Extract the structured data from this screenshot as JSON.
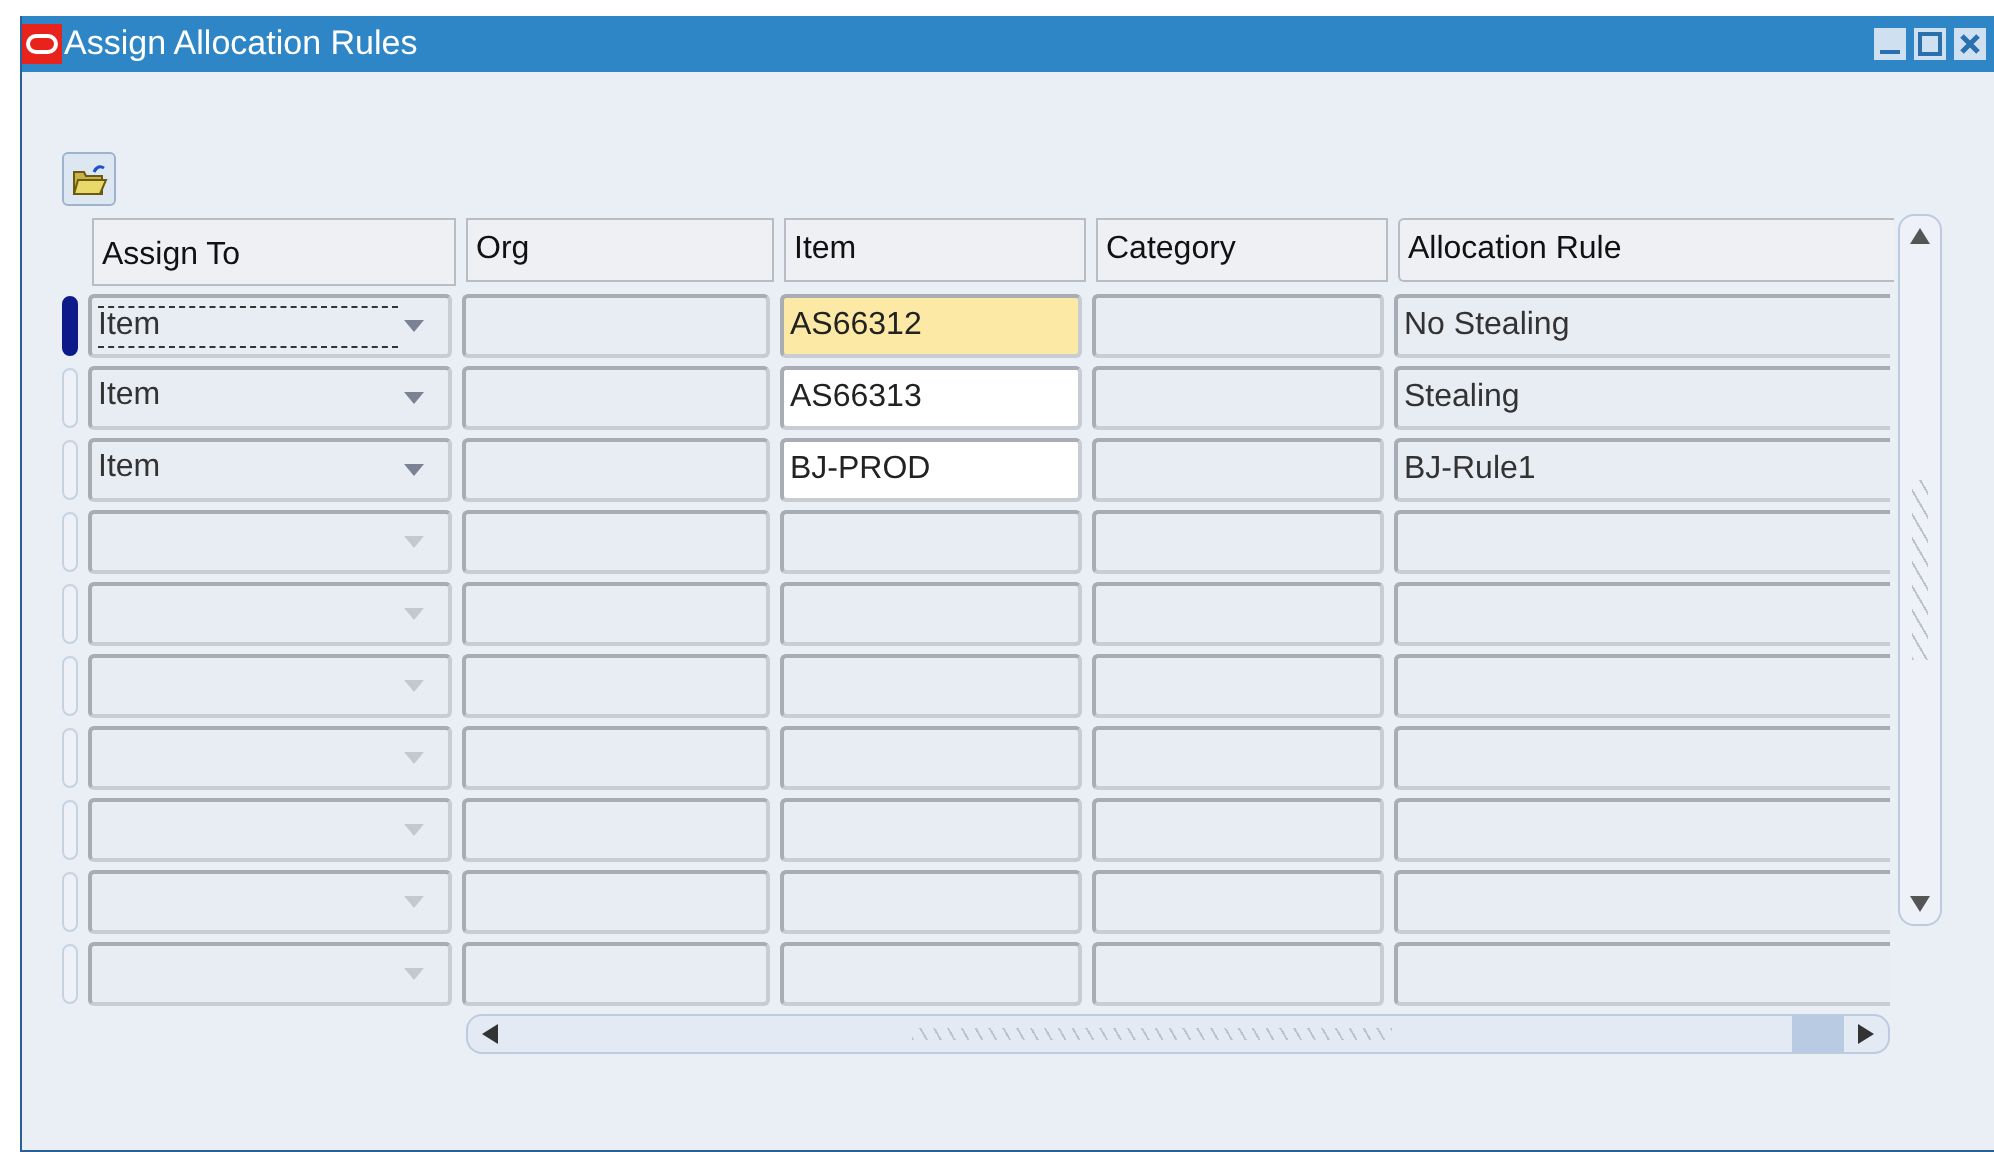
{
  "window": {
    "title": "Assign Allocation Rules"
  },
  "table": {
    "columns": [
      "Assign To",
      "Org",
      "Item",
      "Category",
      "Allocation Rule"
    ],
    "rows": [
      {
        "selected": true,
        "assign_to": "Item",
        "item": "AS66312",
        "allocation_rule": "No Stealing"
      },
      {
        "selected": false,
        "assign_to": "Item",
        "item": "AS66313",
        "allocation_rule": "Stealing"
      },
      {
        "selected": false,
        "assign_to": "Item",
        "item": "BJ-PROD",
        "allocation_rule": "BJ-Rule1"
      },
      {
        "selected": false
      },
      {
        "selected": false
      },
      {
        "selected": false
      },
      {
        "selected": false
      },
      {
        "selected": false
      },
      {
        "selected": false
      },
      {
        "selected": false
      }
    ]
  }
}
